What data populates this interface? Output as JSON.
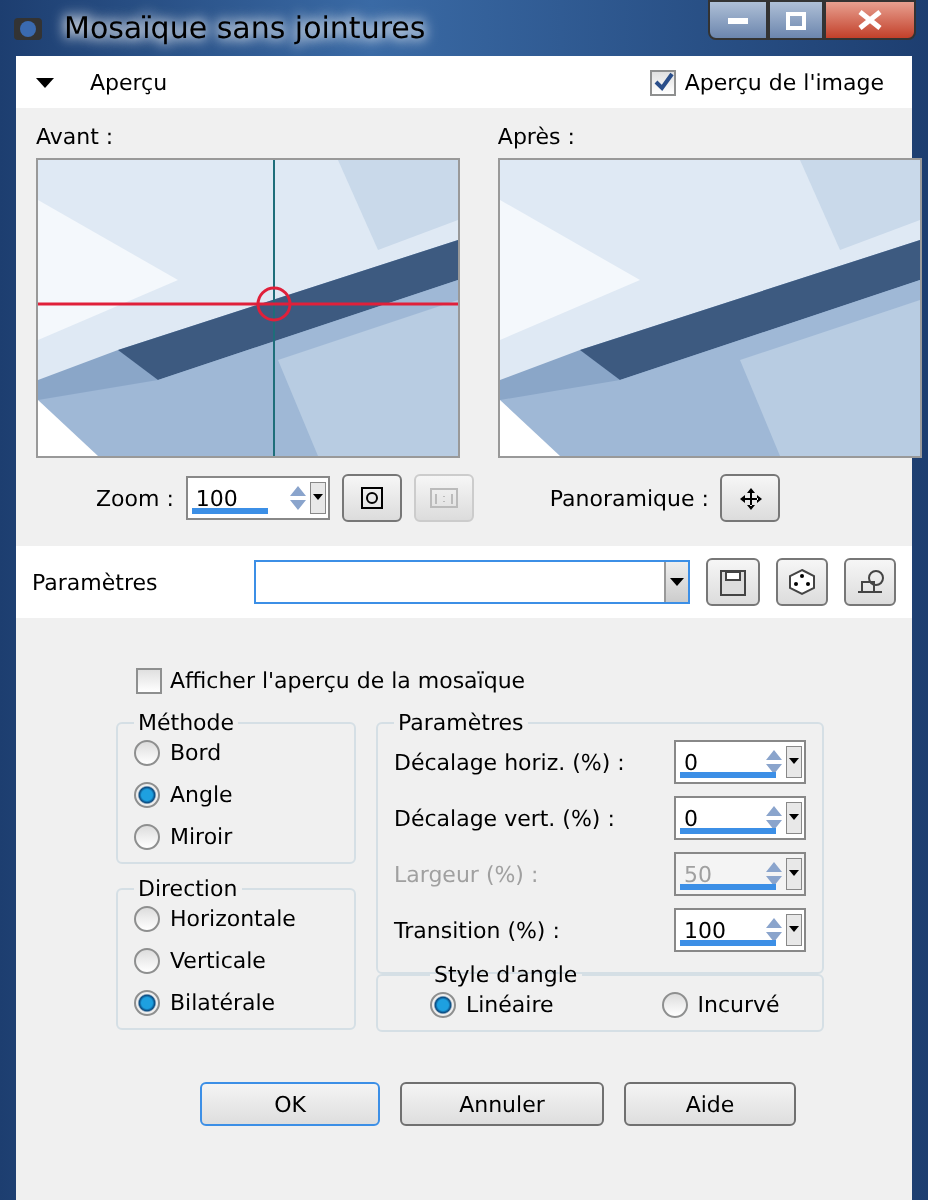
{
  "window": {
    "title": "Mosaïque sans jointures"
  },
  "preview_section": {
    "label": "Aperçu",
    "expanded": true,
    "show_image": {
      "label": "Aperçu de l'image",
      "checked": true
    }
  },
  "before": {
    "label": "Avant :"
  },
  "after": {
    "label": "Après :"
  },
  "zoom": {
    "label": "Zoom :",
    "value": "100"
  },
  "pan": {
    "label": "Panoramique :"
  },
  "presets": {
    "label": "Paramètres"
  },
  "tile_preview": {
    "label": "Afficher l'aperçu de la mosaïque",
    "checked": false
  },
  "method": {
    "title": "Méthode",
    "options": [
      {
        "label": "Bord",
        "selected": false
      },
      {
        "label": "Angle",
        "selected": true
      },
      {
        "label": "Miroir",
        "selected": false
      }
    ]
  },
  "settings": {
    "title": "Paramètres",
    "fields": [
      {
        "label": "Décalage horiz. (%) :",
        "value": "0",
        "disabled": false
      },
      {
        "label": "Décalage vert. (%) :",
        "value": "0",
        "disabled": false
      },
      {
        "label": "Largeur (%) :",
        "value": "50",
        "disabled": true
      },
      {
        "label": "Transition (%) :",
        "value": "100",
        "disabled": false
      }
    ]
  },
  "direction": {
    "title": "Direction",
    "options": [
      {
        "label": "Horizontale",
        "selected": false
      },
      {
        "label": "Verticale",
        "selected": false
      },
      {
        "label": "Bilatérale",
        "selected": true
      }
    ]
  },
  "corner_style": {
    "title": "Style d'angle",
    "options": [
      {
        "label": "Linéaire",
        "selected": true
      },
      {
        "label": "Incurvé",
        "selected": false
      }
    ]
  },
  "buttons": [
    {
      "label": "OK",
      "default": true
    },
    {
      "label": "Annuler",
      "default": false
    },
    {
      "label": "Aide",
      "default": false
    }
  ]
}
